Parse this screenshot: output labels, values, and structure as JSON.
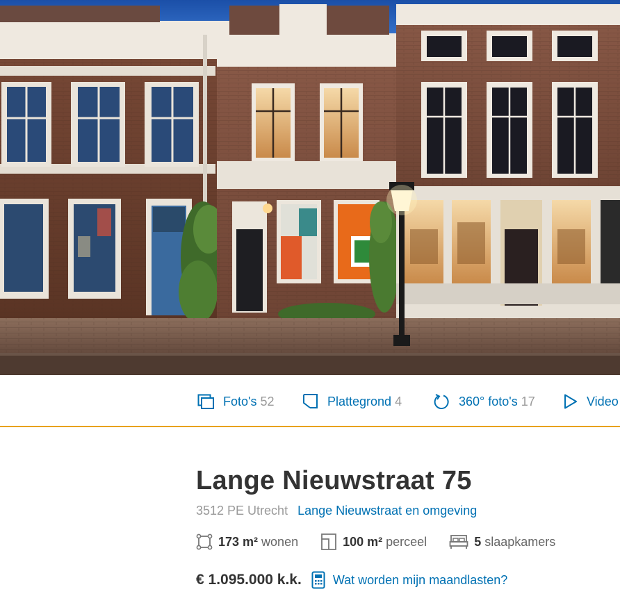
{
  "hero": {
    "image": "house-facade-photo"
  },
  "media": {
    "photos": {
      "label": "Foto's",
      "count": "52",
      "icon": "photos-icon"
    },
    "floorplan": {
      "label": "Plattegrond",
      "count": "4",
      "icon": "floorplan-icon"
    },
    "view360": {
      "label": "360° foto's",
      "count": "17",
      "icon": "rotate-360-icon"
    },
    "video": {
      "label": "Video",
      "icon": "play-icon"
    }
  },
  "listing": {
    "title": "Lange Nieuwstraat 75",
    "postal": "3512 PE Utrecht",
    "area_link": "Lange Nieuwstraat en omgeving",
    "living_area": {
      "value": "173 m²",
      "unit": "wonen"
    },
    "plot": {
      "value": "100 m²",
      "unit": "perceel"
    },
    "bedrooms": {
      "value": "5",
      "unit": "slaapkamers"
    },
    "price": "€ 1.095.000 k.k.",
    "calc_link": "Wat worden mijn maandlasten?"
  },
  "colors": {
    "link": "#0071b3",
    "accent": "#e8a20c",
    "muted": "#999999",
    "text": "#333333"
  }
}
